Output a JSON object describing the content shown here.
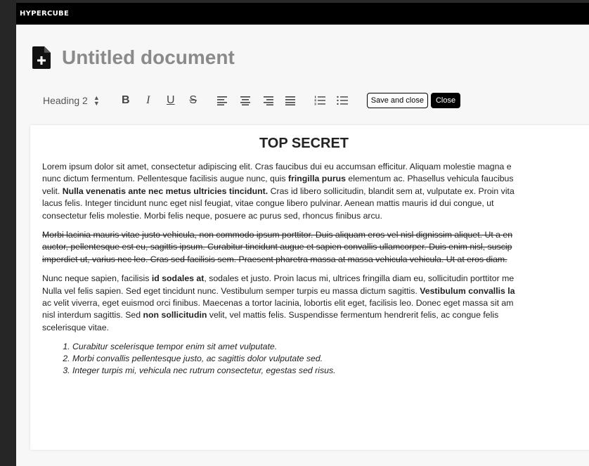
{
  "app": {
    "title": "HYPERCUBE"
  },
  "document": {
    "title": "Untitled document"
  },
  "toolbar": {
    "block_style": "Heading 2",
    "bold": "B",
    "italic": "I",
    "underline": "U",
    "strike": "S",
    "align_left": "left",
    "align_center": "center",
    "align_right": "right",
    "align_justify": "justify",
    "ordered_list": "ordered-list",
    "bullet_list": "bullet-list",
    "save_label": "Save and close",
    "close_label": "Close"
  },
  "content": {
    "heading": "TOP SECRET",
    "p1": [
      [
        {
          "t": "Lorem ipsum dolor sit amet, consectetur adipiscing elit. Cras faucibus dui eu accumsan efficitur. Aliquam molestie magna e"
        }
      ],
      [
        {
          "t": "nunc dictum fermentum. Pellentesque facilisis augue nunc, quis "
        },
        {
          "t": "fringilla purus",
          "b": true
        },
        {
          "t": " elementum ac. Phasellus vehicula faucibus"
        }
      ],
      [
        {
          "t": "velit. "
        },
        {
          "t": "Nulla venenatis ante nec metus ultricies tincidunt.",
          "b": true
        },
        {
          "t": " Cras id libero sollicitudin, blandit sem at, vulputate ex. Proin vita"
        }
      ],
      [
        {
          "t": "lacus felis. Integer tincidunt nunc eget nisl feugiat, vitae congue libero pulvinar. Aenean mattis mauris id dui congue, ut"
        }
      ],
      [
        {
          "t": "consectetur felis molestie. Morbi felis neque, posuere ac purus sed, rhoncus finibus arcu."
        }
      ]
    ],
    "p2": [
      "Morbi lacinia mauris vitae justo vehicula, non commodo ipsum porttitor. Duis aliquam eros vel nisl dignissim aliquet. Ut a en",
      "auctor, pellentesque est eu, sagittis ipsum. Curabitur tincidunt augue et sapien convallis ullamcorper. Duis enim nisl, suscip",
      "imperdiet ut, varius nec leo. Cras sed facilisis sem. Praesent pharetra massa at massa vehicula vehicula. Ut at eros diam."
    ],
    "p3": [
      [
        {
          "t": "Nunc neque sapien, facilisis "
        },
        {
          "t": "id sodales at",
          "b": true
        },
        {
          "t": ", sodales et justo. Proin lacus mi, ultrices fringilla diam eu, sollicitudin porttitor me"
        }
      ],
      [
        {
          "t": "Nulla vel felis sapien. Sed eget tincidunt nunc. Vestibulum semper turpis eu massa dictum sagittis. "
        },
        {
          "t": "Vestibulum convallis la",
          "b": true
        }
      ],
      [
        {
          "t": "ac velit viverra, eget euismod orci finibus. Maecenas a tortor lacinia, lobortis elit eget, facilisis leo. Donec eget massa sit am"
        }
      ],
      [
        {
          "t": "nisl interdum sagittis. Sed "
        },
        {
          "t": "non sollicitudin",
          "b": true
        },
        {
          "t": " velit, vel mattis felis. Suspendisse fermentum hendrerit felis, ac congue felis"
        }
      ],
      [
        {
          "t": "scelerisque vitae."
        }
      ]
    ],
    "list": [
      "Curabitur scelerisque tempor enim sit amet vulputate.",
      "Morbi convallis pellentesque justo, ac sagittis dolor vulputate sed.",
      "Integer turpis mi, vehicula nec rutrum consectetur, egestas sed risus."
    ]
  }
}
